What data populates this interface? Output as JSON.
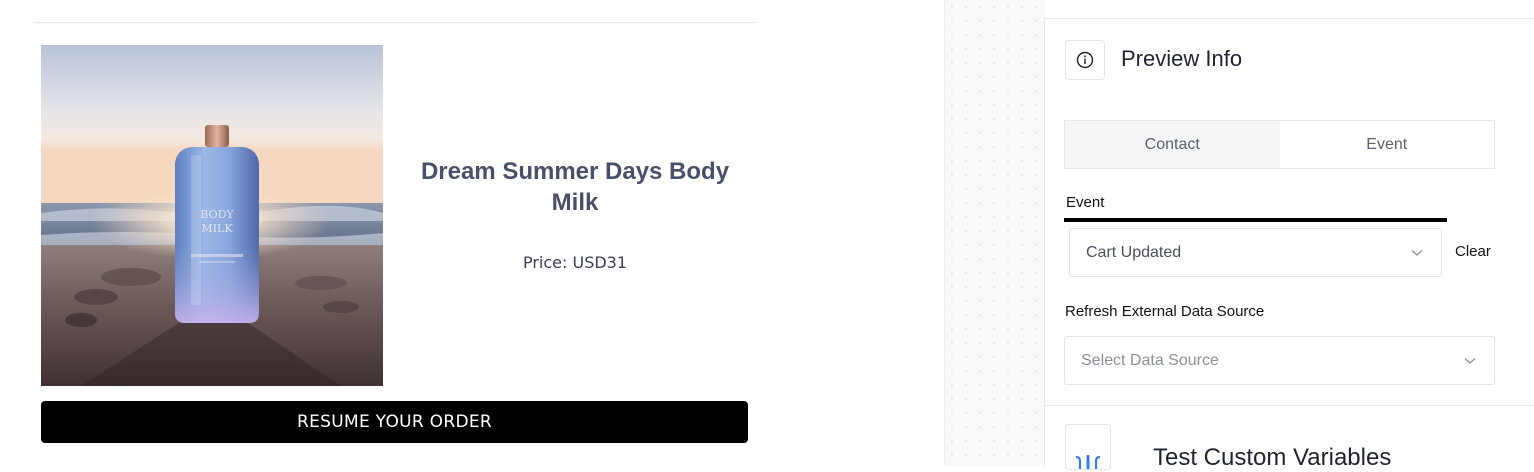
{
  "product": {
    "image_alt": "Body Milk bottle on a beach at sunset",
    "bottle_label_line1": "BODY",
    "bottle_label_line2": "MILK",
    "title": "Dream Summer Days Body Milk",
    "price": "Price: USD31",
    "cta_label": "RESUME YOUR ORDER"
  },
  "preview_panel": {
    "title": "Preview Info",
    "title_icon": "info-icon",
    "tabs": [
      {
        "label": "Contact",
        "active": true
      },
      {
        "label": "Event",
        "active": false
      }
    ],
    "event_label": "Event",
    "event_value": "Cart Updated",
    "clear_label": "Clear",
    "refresh_label": "Refresh External Data Source",
    "datasource_placeholder": "Select Data Source",
    "next_section_title": "Test Custom Variables",
    "next_section_icon": "curly-braces-icon"
  },
  "colors": {
    "cta_background": "#000000",
    "title_text": "#4a5068",
    "panel_border": "#e6e8ec",
    "active_tab_bg": "#f5f6f7"
  }
}
